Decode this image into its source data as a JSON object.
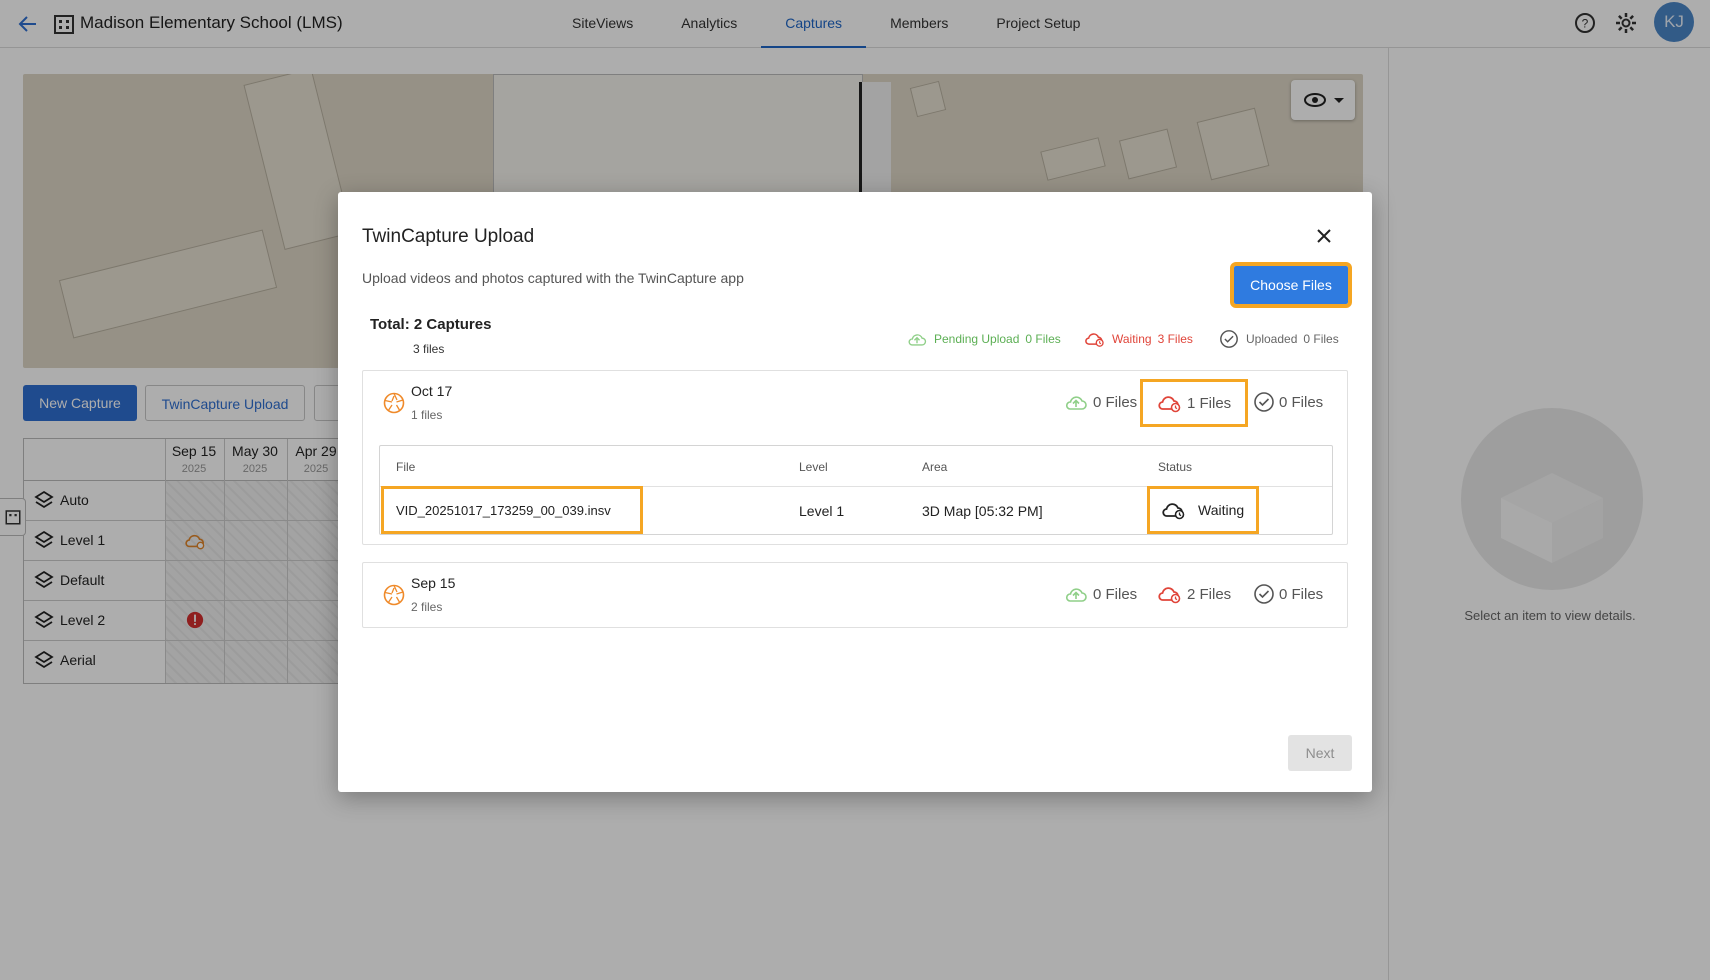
{
  "header": {
    "project_title": "Madison Elementary School (LMS)",
    "tabs": [
      {
        "label": "SiteViews"
      },
      {
        "label": "Analytics"
      },
      {
        "label": "Captures"
      },
      {
        "label": "Members"
      },
      {
        "label": "Project Setup"
      }
    ],
    "active_tab": "Captures",
    "avatar_initials": "KJ"
  },
  "background": {
    "new_capture_label": "New Capture",
    "twincapture_upload_label": "TwinCapture Upload",
    "grid": {
      "dates": [
        {
          "date": "Sep 15",
          "year": "2025"
        },
        {
          "date": "May 30",
          "year": "2025"
        },
        {
          "date": "Apr 29",
          "year": "2025"
        }
      ],
      "rows": [
        {
          "label": "Auto"
        },
        {
          "label": "Level 1"
        },
        {
          "label": "Default"
        },
        {
          "label": "Level 2"
        },
        {
          "label": "Aerial"
        }
      ]
    },
    "right_panel_text": "Select an item to view details."
  },
  "modal": {
    "title": "TwinCapture Upload",
    "subtitle": "Upload videos and photos captured with the TwinCapture app",
    "choose_files_label": "Choose Files",
    "total_label": "Total: 2 Captures",
    "total_files": "3 files",
    "legend": {
      "pending_label": "Pending Upload",
      "pending_count": "0 Files",
      "waiting_label": "Waiting",
      "waiting_count": "3 Files",
      "uploaded_label": "Uploaded",
      "uploaded_count": "0 Files"
    },
    "groups": [
      {
        "date": "Oct 17",
        "count": "1 files",
        "pending": "0 Files",
        "waiting": "1 Files",
        "uploaded": "0 Files",
        "table": {
          "headers": {
            "file": "File",
            "level": "Level",
            "area": "Area",
            "status": "Status"
          },
          "rows": [
            {
              "file": "VID_20251017_173259_00_039.insv",
              "level": "Level 1",
              "area": "3D Map [05:32 PM]",
              "status": "Waiting"
            }
          ]
        }
      },
      {
        "date": "Sep 15",
        "count": "2 files",
        "pending": "0 Files",
        "waiting": "2 Files",
        "uploaded": "0 Files"
      }
    ],
    "next_label": "Next"
  },
  "colors": {
    "accent": "#2f7be0",
    "highlight": "#f5a623",
    "waiting": "#e0453a",
    "pending": "#5caf54"
  }
}
